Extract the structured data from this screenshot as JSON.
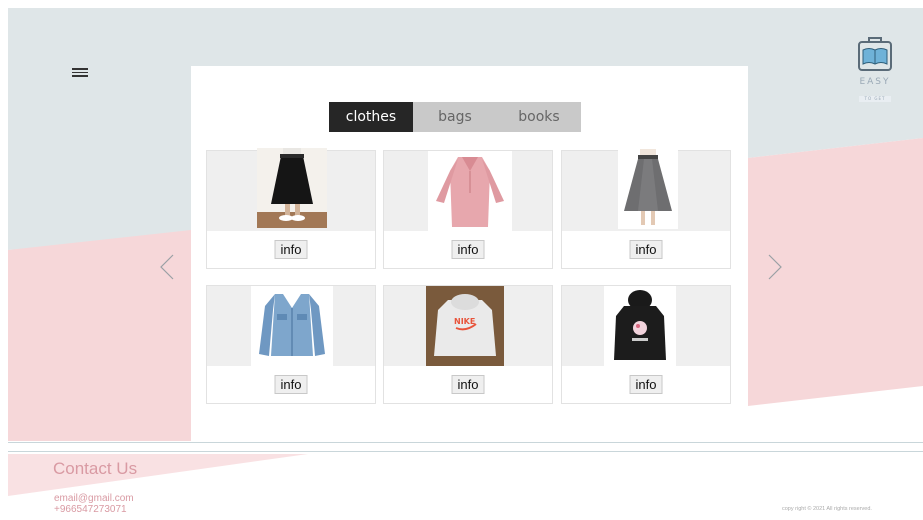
{
  "colors": {
    "bg_blue": "#dfe6e8",
    "bg_pink": "#f6d7d9",
    "tab_active": "#262626",
    "tab_inactive": "#c9c9c9",
    "footer_text": "#d99aa3"
  },
  "header": {
    "menu_icon": "hamburger-icon"
  },
  "logo": {
    "brand": "EASY",
    "tagline": "TO GET",
    "icon": "book-bag-icon"
  },
  "tabs": [
    {
      "label": "clothes",
      "active": true
    },
    {
      "label": "bags",
      "active": false
    },
    {
      "label": "books",
      "active": false
    }
  ],
  "products": [
    {
      "image": "black-skirt-photo",
      "button": "info"
    },
    {
      "image": "pink-blouse-photo",
      "button": "info"
    },
    {
      "image": "grey-skirt-photo",
      "button": "info"
    },
    {
      "image": "denim-jacket-photo",
      "button": "info"
    },
    {
      "image": "white-hoodie-photo",
      "button": "info"
    },
    {
      "image": "black-hoodie-photo",
      "button": "info"
    }
  ],
  "carousel": {
    "prev_icon": "chevron-left-icon",
    "next_icon": "chevron-right-icon"
  },
  "footer": {
    "title": "Contact Us",
    "email": "email@gmail.com",
    "phone": "+966547273071",
    "copyright": "copy right © 2021 All rights reserved."
  }
}
